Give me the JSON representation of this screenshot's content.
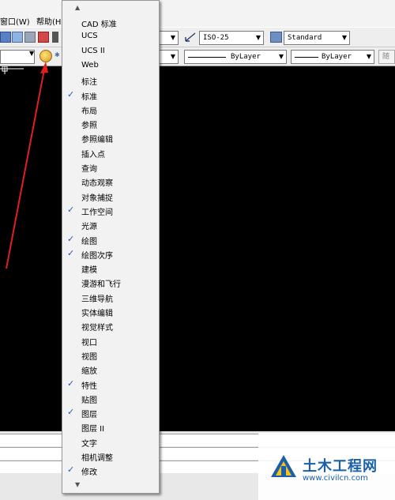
{
  "menubar": {
    "items": [
      "窗口(W)",
      "帮助(H"
    ]
  },
  "toolbar1": {
    "dim_style": "ISO-25",
    "table_style": "Standard"
  },
  "toolbar2": {
    "linetype": "ByLayer",
    "lineweight": "ByLayer",
    "plotstyle_partial": "随"
  },
  "toolbar_menu": {
    "items": [
      {
        "label": "CAD 标准",
        "checked": false
      },
      {
        "label": "UCS",
        "checked": false
      },
      {
        "label": "UCS II",
        "checked": false
      },
      {
        "label": "Web",
        "checked": false
      },
      {
        "label": "标注",
        "checked": false
      },
      {
        "label": "标准",
        "checked": true
      },
      {
        "label": "布局",
        "checked": false
      },
      {
        "label": "参照",
        "checked": false
      },
      {
        "label": "参照编辑",
        "checked": false
      },
      {
        "label": "插入点",
        "checked": false
      },
      {
        "label": "查询",
        "checked": false
      },
      {
        "label": "动态观察",
        "checked": false
      },
      {
        "label": "对象捕捉",
        "checked": false
      },
      {
        "label": "工作空间",
        "checked": true
      },
      {
        "label": "光源",
        "checked": false
      },
      {
        "label": "绘图",
        "checked": true
      },
      {
        "label": "绘图次序",
        "checked": true
      },
      {
        "label": "建模",
        "checked": false
      },
      {
        "label": "漫游和飞行",
        "checked": false
      },
      {
        "label": "三维导航",
        "checked": false
      },
      {
        "label": "实体编辑",
        "checked": false
      },
      {
        "label": "视觉样式",
        "checked": false
      },
      {
        "label": "视口",
        "checked": false
      },
      {
        "label": "视图",
        "checked": false
      },
      {
        "label": "缩放",
        "checked": false
      },
      {
        "label": "特性",
        "checked": true
      },
      {
        "label": "贴图",
        "checked": false
      },
      {
        "label": "图层",
        "checked": true
      },
      {
        "label": "图层 II",
        "checked": false
      },
      {
        "label": "文字",
        "checked": false
      },
      {
        "label": "相机调整",
        "checked": false
      },
      {
        "label": "修改",
        "checked": true
      }
    ]
  },
  "watermark": {
    "title": "土木工程网",
    "url": "www.civilcn.com"
  },
  "colors": {
    "canvas": "#000000",
    "check": "#2d4fb8",
    "annotation_arrow": "#e02020",
    "watermark_blue": "#1a5fa8"
  }
}
